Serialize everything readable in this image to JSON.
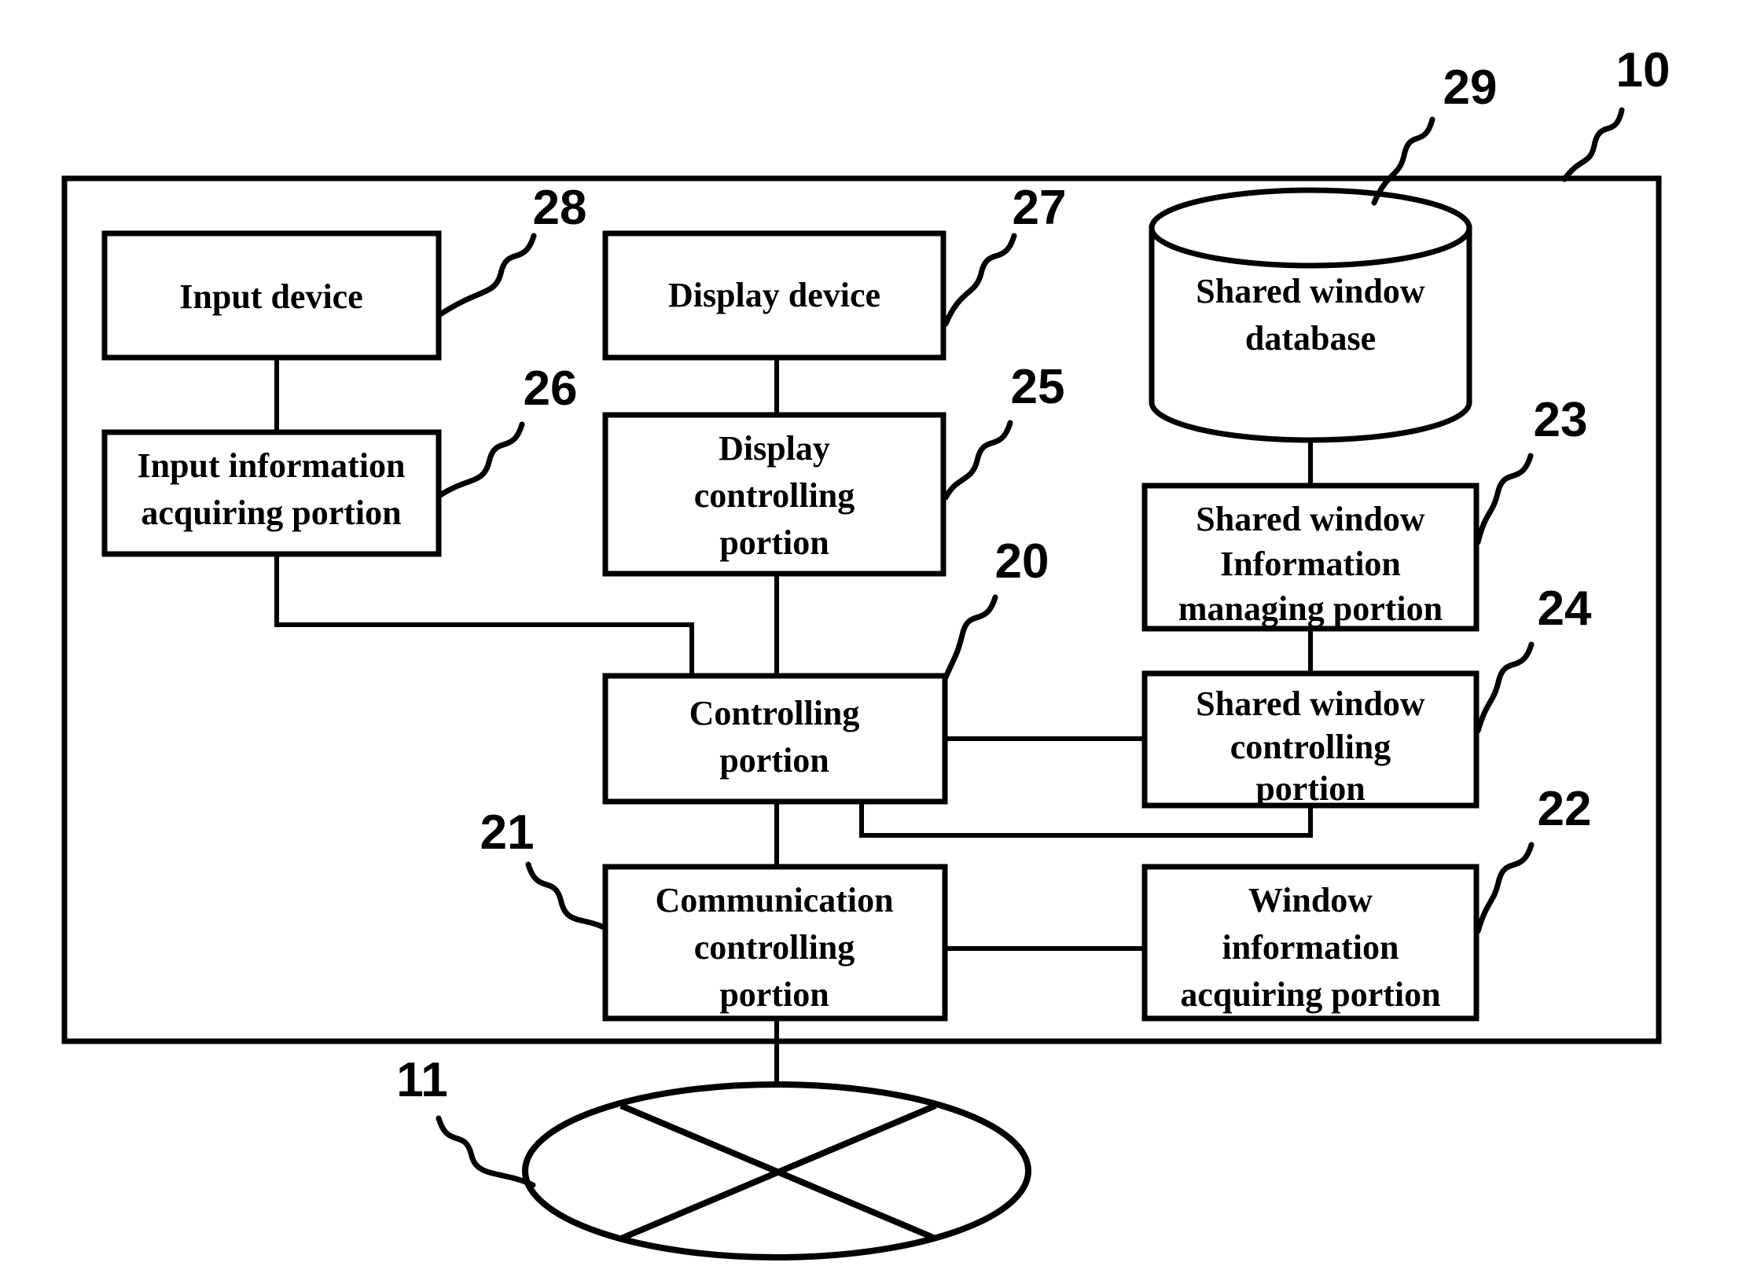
{
  "figure": {
    "type": "patent-block-diagram",
    "system_ref": "10",
    "network_ref": "11"
  },
  "blocks": {
    "input_device": {
      "label": "Input device",
      "ref": "28"
    },
    "display_device": {
      "label": "Display device",
      "ref": "27"
    },
    "shared_window_database": {
      "label_line1": "Shared window",
      "label_line2": "database",
      "ref": "29"
    },
    "input_information_acquiring_portion": {
      "label_line1": "Input information",
      "label_line2": "acquiring portion",
      "ref": "26"
    },
    "display_controlling_portion": {
      "label_line1": "Display",
      "label_line2": "controlling",
      "label_line3": "portion",
      "ref": "25"
    },
    "shared_window_information_managing_portion": {
      "label_line1": "Shared window",
      "label_line2": "Information",
      "label_line3": "managing portion",
      "ref": "23"
    },
    "controlling_portion": {
      "label_line1": "Controlling",
      "label_line2": "portion",
      "ref": "20"
    },
    "shared_window_controlling_portion": {
      "label_line1": "Shared window",
      "label_line2": "controlling",
      "label_line3": "portion",
      "ref": "24"
    },
    "communication_controlling_portion": {
      "label_line1": "Communication",
      "label_line2": "controlling",
      "label_line3": "portion",
      "ref": "21"
    },
    "window_information_acquiring_portion": {
      "label_line1": "Window",
      "label_line2": "information",
      "label_line3": "acquiring portion",
      "ref": "22"
    }
  },
  "colors": {
    "line": "#000000",
    "fill": "#ffffff"
  }
}
